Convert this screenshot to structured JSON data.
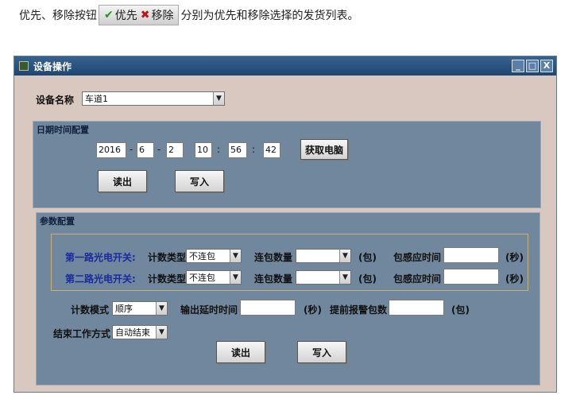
{
  "intro": {
    "before": "优先、移除按钮",
    "btn_priority": "优先",
    "btn_remove": "移除",
    "after": "分别为优先和移除选择的发货列表。"
  },
  "window": {
    "title": "设备操作",
    "controls": {
      "minimize": "_",
      "maximize": "□",
      "close": "X"
    }
  },
  "device": {
    "label": "设备名称",
    "value": "车道1"
  },
  "datetime": {
    "title": "日期时间配置",
    "year": "2016",
    "month": "6",
    "day": "2",
    "hour": "10",
    "minute": "56",
    "second": "42",
    "sep_date": "-",
    "sep_time": ":",
    "get_pc_button": "获取电脑",
    "read_button": "读出",
    "write_button": "写入"
  },
  "params": {
    "title": "参数配置",
    "rows": [
      {
        "name": "第一路光电开关:",
        "type_label": "计数类型",
        "type_value": "不连包",
        "count_label": "连包数量",
        "count_value": "",
        "unit_bao": "(包)",
        "sense_label": "包感应时间",
        "sense_value": "",
        "unit_sec": "(秒)"
      },
      {
        "name": "第二路光电开关:",
        "type_label": "计数类型",
        "type_value": "不连包",
        "count_label": "连包数量",
        "count_value": "",
        "unit_bao": "(包)",
        "sense_label": "包感应时间",
        "sense_value": "",
        "unit_sec": "(秒)"
      }
    ],
    "mode_label": "计数模式",
    "mode_value": "顺序",
    "delay_label": "输出延时时间",
    "delay_value": "",
    "delay_unit": "(秒)",
    "alarm_label": "提前报警包数",
    "alarm_value": "",
    "alarm_unit": "(包)",
    "end_label": "结束工作方式",
    "end_value": "自动结束",
    "read_button": "读出",
    "write_button": "写入"
  }
}
